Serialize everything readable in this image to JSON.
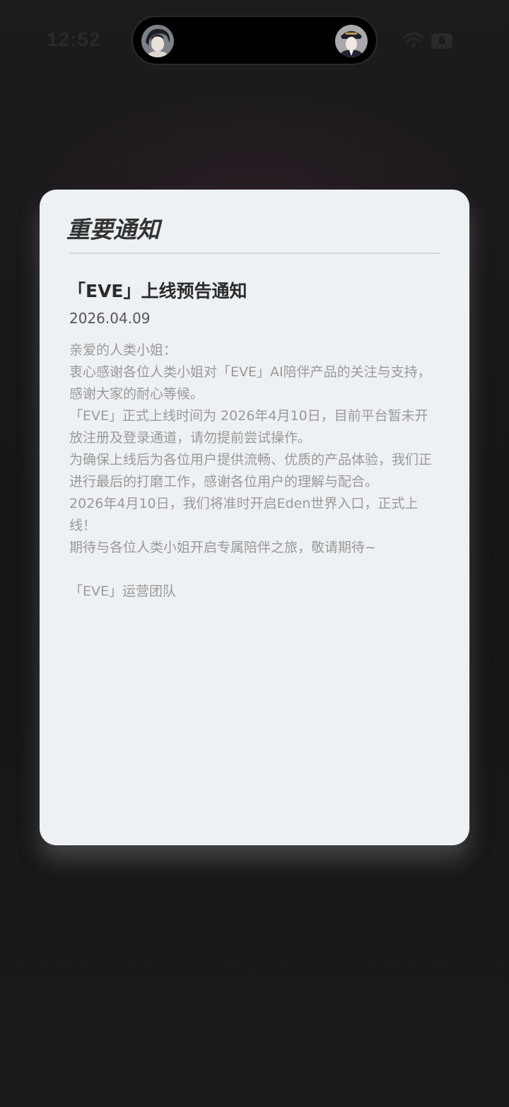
{
  "status_bar": {
    "time": "12:52",
    "battery": "6",
    "wifi_icon": "wifi-icon",
    "battery_icon": "battery-icon"
  },
  "dynamic_island": {
    "left_avatar": "avatar-icon",
    "right_avatar": "avatar-icon"
  },
  "modal": {
    "title": "重要通知",
    "notice_title": "「EVE」上线预告通知",
    "date": "2026.04.09",
    "body": [
      "亲爱的人类小姐：",
      "衷心感谢各位人类小姐对「EVE」AI陪伴产品的关注与支持，感谢大家的耐心等候。",
      "「EVE」正式上线时间为 2026年4月10日，目前平台暂未开放注册及登录通道，请勿提前尝试操作。",
      "为确保上线后为各位用户提供流畅、优质的产品体验，我们正进行最后的打磨工作，感谢各位用户的理解与配合。",
      "2026年4月10日，我们将准时开启Eden世界入口，正式上线！",
      "期待与各位人类小姐开启专属陪伴之旅，敬请期待~"
    ],
    "signature": "「EVE」运营团队"
  }
}
